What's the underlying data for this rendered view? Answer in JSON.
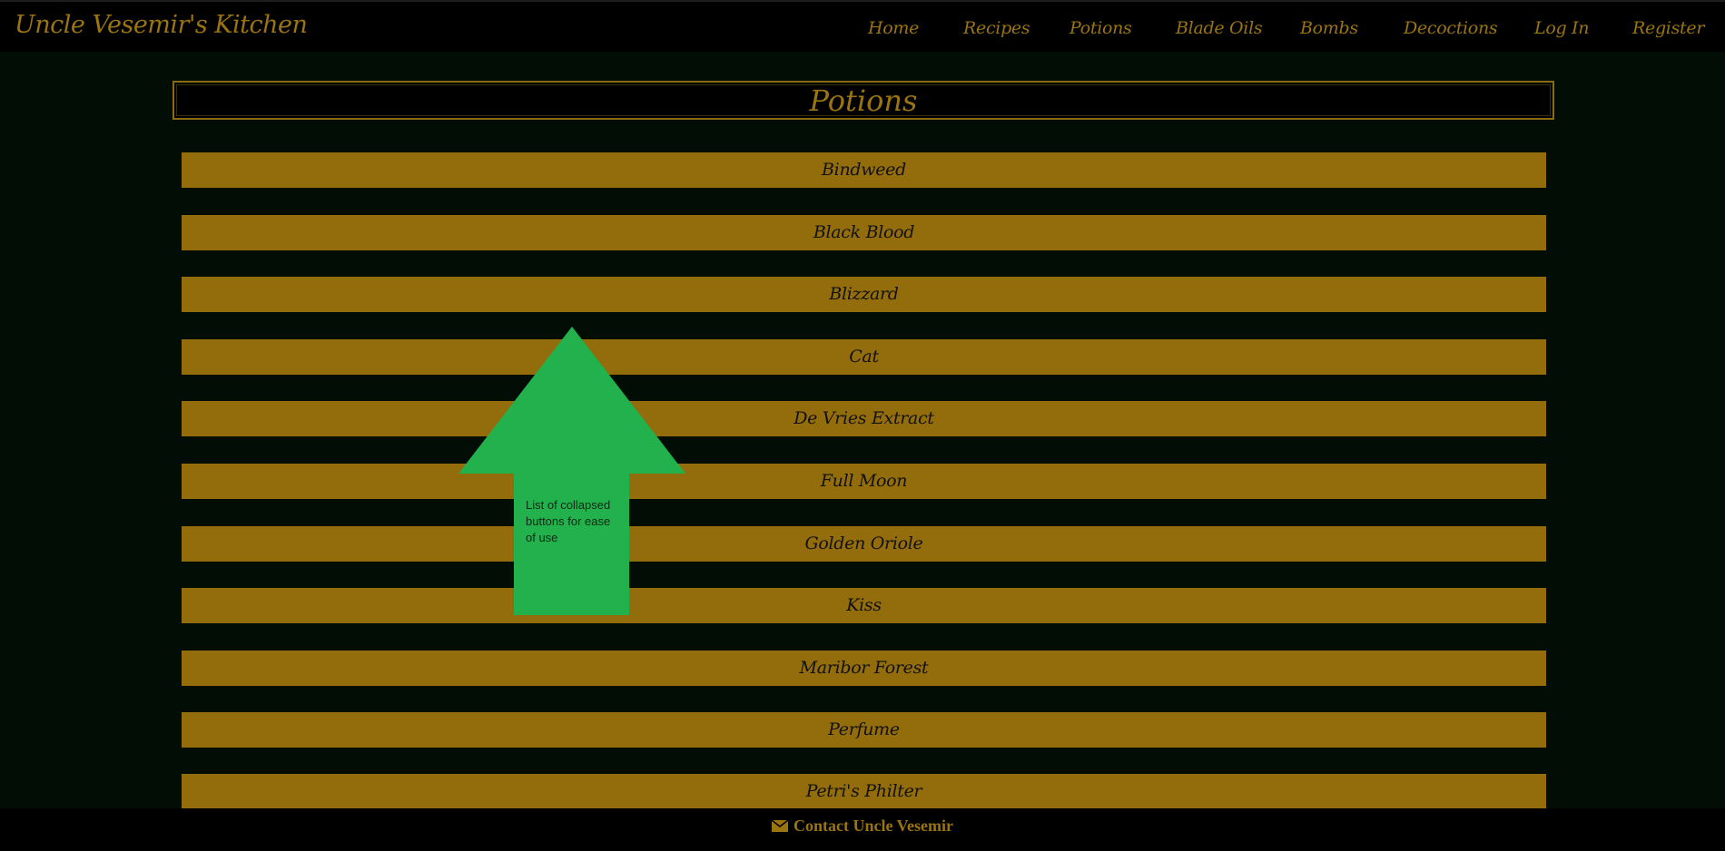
{
  "navbar": {
    "brand": "Uncle Vesemir's Kitchen",
    "links": [
      "Home",
      "Recipes",
      "Potions",
      "Blade Oils",
      "Bombs",
      "Decoctions",
      "Log In",
      "Register"
    ]
  },
  "page": {
    "title": "Potions"
  },
  "potions": [
    "Bindweed",
    "Black Blood",
    "Blizzard",
    "Cat",
    "De Vries Extract",
    "Full Moon",
    "Golden Oriole",
    "Kiss",
    "Maribor Forest",
    "Perfume",
    "Petri's Philter"
  ],
  "annotation": {
    "text": "List of collapsed buttons for ease of use"
  },
  "footer": {
    "contact_label": "Contact Uncle Vesemir"
  },
  "icons": {
    "footer": "envelope-icon",
    "annotation": "up-arrow-icon"
  },
  "colors": {
    "accent": "#936d0b",
    "background": "#020d06",
    "annotation": "#22b14c"
  }
}
